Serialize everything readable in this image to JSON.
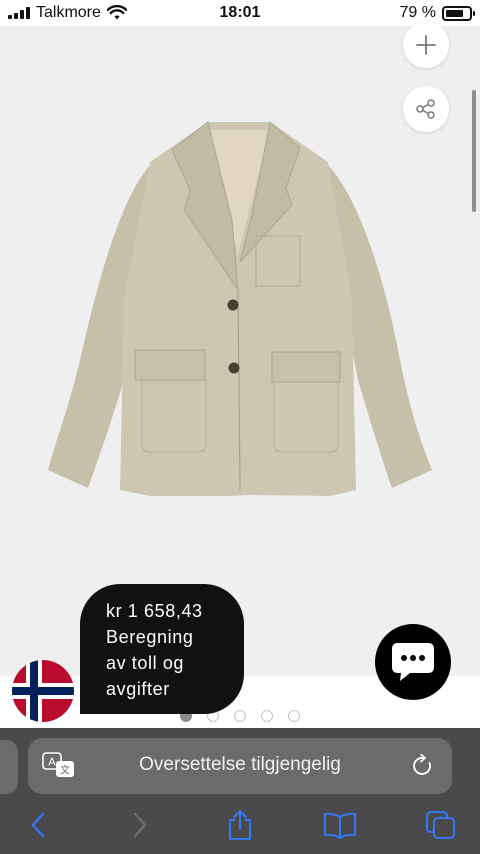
{
  "status_bar": {
    "carrier": "Talkmore",
    "time": "18:01",
    "battery_percent": "79 %",
    "battery_level": 0.79
  },
  "product": {
    "add_icon": "plus-icon",
    "share_icon": "share-icon"
  },
  "price_bubble": {
    "price": "kr 1 658,43",
    "duty_text": [
      "Beregning",
      "av toll og",
      "avgifter"
    ]
  },
  "flag": {
    "country": "Norway",
    "colors": {
      "red": "#ba0c2f",
      "white": "#ffffff",
      "blue": "#00205b"
    }
  },
  "chat": {
    "icon": "chat-bubble-icon"
  },
  "carousel": {
    "count": 5,
    "active_index": 0
  },
  "browser": {
    "address_text": "Oversettelse tilgjengelig",
    "translate_icon": "translate-icon",
    "reload_icon": "reload-icon",
    "toolbar": [
      "back-icon",
      "forward-icon",
      "share-icon",
      "bookmarks-icon",
      "tabs-icon"
    ],
    "accent_color": "#3478f6"
  }
}
